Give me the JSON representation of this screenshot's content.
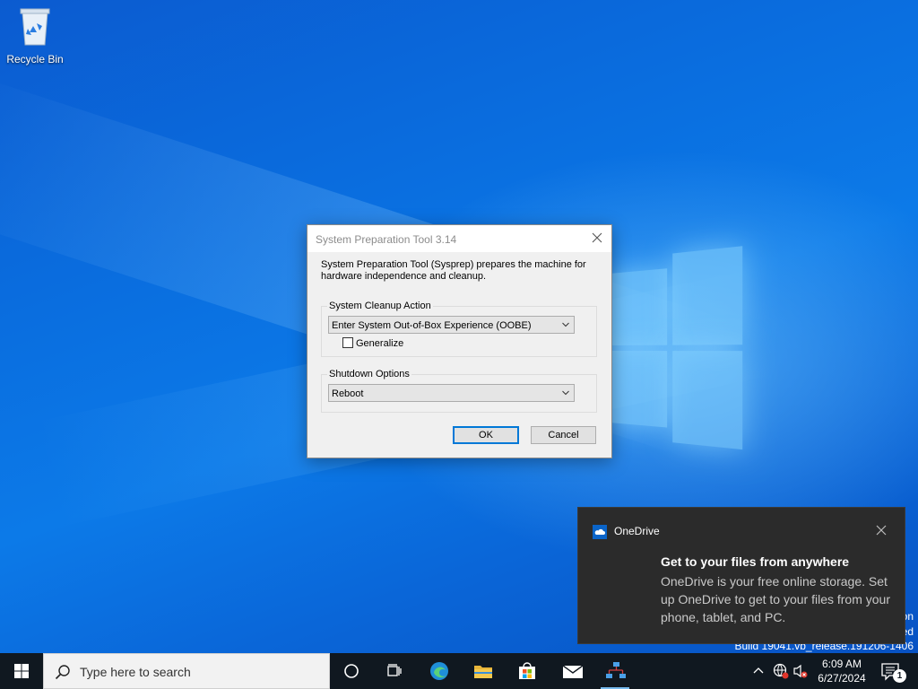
{
  "desktop": {
    "recycle_bin_label": "Recycle Bin",
    "watermark": {
      "line1": "on",
      "line2": "ed",
      "line3": "Build 19041.vb_release.191206-1406"
    }
  },
  "dialog": {
    "title": "System Preparation Tool 3.14",
    "description": "System Preparation Tool (Sysprep) prepares the machine for hardware independence and cleanup.",
    "cleanup_group_label": "System Cleanup Action",
    "cleanup_selected": "Enter System Out-of-Box Experience (OOBE)",
    "generalize_label": "Generalize",
    "generalize_checked": false,
    "shutdown_group_label": "Shutdown Options",
    "shutdown_selected": "Reboot",
    "ok_label": "OK",
    "cancel_label": "Cancel"
  },
  "toast": {
    "app_name": "OneDrive",
    "headline": "Get to your files from anywhere",
    "body": "OneDrive is your free online storage. Set up OneDrive to get to your files from your phone, tablet, and PC."
  },
  "taskbar": {
    "search_placeholder": "Type here to search",
    "pinned": [
      "start-icon",
      "cortana-icon",
      "task-view-icon",
      "edge-icon",
      "file-explorer-icon",
      "store-icon",
      "mail-icon",
      "network-app-icon"
    ],
    "clock_time": "6:09 AM",
    "clock_date": "6/27/2024",
    "notification_count": "1"
  },
  "colors": {
    "accent": "#0078d7",
    "taskbar": "#101820",
    "toast_bg": "#2b2b2b"
  }
}
